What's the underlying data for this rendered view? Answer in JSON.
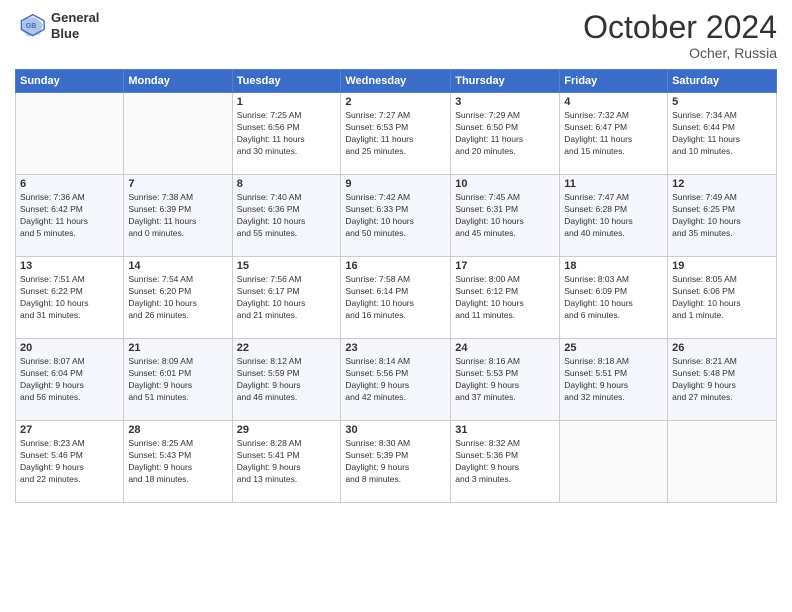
{
  "header": {
    "logo_line1": "General",
    "logo_line2": "Blue",
    "month": "October 2024",
    "location": "Ocher, Russia"
  },
  "days_of_week": [
    "Sunday",
    "Monday",
    "Tuesday",
    "Wednesday",
    "Thursday",
    "Friday",
    "Saturday"
  ],
  "weeks": [
    [
      {
        "day": "",
        "info": ""
      },
      {
        "day": "",
        "info": ""
      },
      {
        "day": "1",
        "info": "Sunrise: 7:25 AM\nSunset: 6:56 PM\nDaylight: 11 hours\nand 30 minutes."
      },
      {
        "day": "2",
        "info": "Sunrise: 7:27 AM\nSunset: 6:53 PM\nDaylight: 11 hours\nand 25 minutes."
      },
      {
        "day": "3",
        "info": "Sunrise: 7:29 AM\nSunset: 6:50 PM\nDaylight: 11 hours\nand 20 minutes."
      },
      {
        "day": "4",
        "info": "Sunrise: 7:32 AM\nSunset: 6:47 PM\nDaylight: 11 hours\nand 15 minutes."
      },
      {
        "day": "5",
        "info": "Sunrise: 7:34 AM\nSunset: 6:44 PM\nDaylight: 11 hours\nand 10 minutes."
      }
    ],
    [
      {
        "day": "6",
        "info": "Sunrise: 7:36 AM\nSunset: 6:42 PM\nDaylight: 11 hours\nand 5 minutes."
      },
      {
        "day": "7",
        "info": "Sunrise: 7:38 AM\nSunset: 6:39 PM\nDaylight: 11 hours\nand 0 minutes."
      },
      {
        "day": "8",
        "info": "Sunrise: 7:40 AM\nSunset: 6:36 PM\nDaylight: 10 hours\nand 55 minutes."
      },
      {
        "day": "9",
        "info": "Sunrise: 7:42 AM\nSunset: 6:33 PM\nDaylight: 10 hours\nand 50 minutes."
      },
      {
        "day": "10",
        "info": "Sunrise: 7:45 AM\nSunset: 6:31 PM\nDaylight: 10 hours\nand 45 minutes."
      },
      {
        "day": "11",
        "info": "Sunrise: 7:47 AM\nSunset: 6:28 PM\nDaylight: 10 hours\nand 40 minutes."
      },
      {
        "day": "12",
        "info": "Sunrise: 7:49 AM\nSunset: 6:25 PM\nDaylight: 10 hours\nand 35 minutes."
      }
    ],
    [
      {
        "day": "13",
        "info": "Sunrise: 7:51 AM\nSunset: 6:22 PM\nDaylight: 10 hours\nand 31 minutes."
      },
      {
        "day": "14",
        "info": "Sunrise: 7:54 AM\nSunset: 6:20 PM\nDaylight: 10 hours\nand 26 minutes."
      },
      {
        "day": "15",
        "info": "Sunrise: 7:56 AM\nSunset: 6:17 PM\nDaylight: 10 hours\nand 21 minutes."
      },
      {
        "day": "16",
        "info": "Sunrise: 7:58 AM\nSunset: 6:14 PM\nDaylight: 10 hours\nand 16 minutes."
      },
      {
        "day": "17",
        "info": "Sunrise: 8:00 AM\nSunset: 6:12 PM\nDaylight: 10 hours\nand 11 minutes."
      },
      {
        "day": "18",
        "info": "Sunrise: 8:03 AM\nSunset: 6:09 PM\nDaylight: 10 hours\nand 6 minutes."
      },
      {
        "day": "19",
        "info": "Sunrise: 8:05 AM\nSunset: 6:06 PM\nDaylight: 10 hours\nand 1 minute."
      }
    ],
    [
      {
        "day": "20",
        "info": "Sunrise: 8:07 AM\nSunset: 6:04 PM\nDaylight: 9 hours\nand 56 minutes."
      },
      {
        "day": "21",
        "info": "Sunrise: 8:09 AM\nSunset: 6:01 PM\nDaylight: 9 hours\nand 51 minutes."
      },
      {
        "day": "22",
        "info": "Sunrise: 8:12 AM\nSunset: 5:59 PM\nDaylight: 9 hours\nand 46 minutes."
      },
      {
        "day": "23",
        "info": "Sunrise: 8:14 AM\nSunset: 5:56 PM\nDaylight: 9 hours\nand 42 minutes."
      },
      {
        "day": "24",
        "info": "Sunrise: 8:16 AM\nSunset: 5:53 PM\nDaylight: 9 hours\nand 37 minutes."
      },
      {
        "day": "25",
        "info": "Sunrise: 8:18 AM\nSunset: 5:51 PM\nDaylight: 9 hours\nand 32 minutes."
      },
      {
        "day": "26",
        "info": "Sunrise: 8:21 AM\nSunset: 5:48 PM\nDaylight: 9 hours\nand 27 minutes."
      }
    ],
    [
      {
        "day": "27",
        "info": "Sunrise: 8:23 AM\nSunset: 5:46 PM\nDaylight: 9 hours\nand 22 minutes."
      },
      {
        "day": "28",
        "info": "Sunrise: 8:25 AM\nSunset: 5:43 PM\nDaylight: 9 hours\nand 18 minutes."
      },
      {
        "day": "29",
        "info": "Sunrise: 8:28 AM\nSunset: 5:41 PM\nDaylight: 9 hours\nand 13 minutes."
      },
      {
        "day": "30",
        "info": "Sunrise: 8:30 AM\nSunset: 5:39 PM\nDaylight: 9 hours\nand 8 minutes."
      },
      {
        "day": "31",
        "info": "Sunrise: 8:32 AM\nSunset: 5:36 PM\nDaylight: 9 hours\nand 3 minutes."
      },
      {
        "day": "",
        "info": ""
      },
      {
        "day": "",
        "info": ""
      }
    ]
  ]
}
